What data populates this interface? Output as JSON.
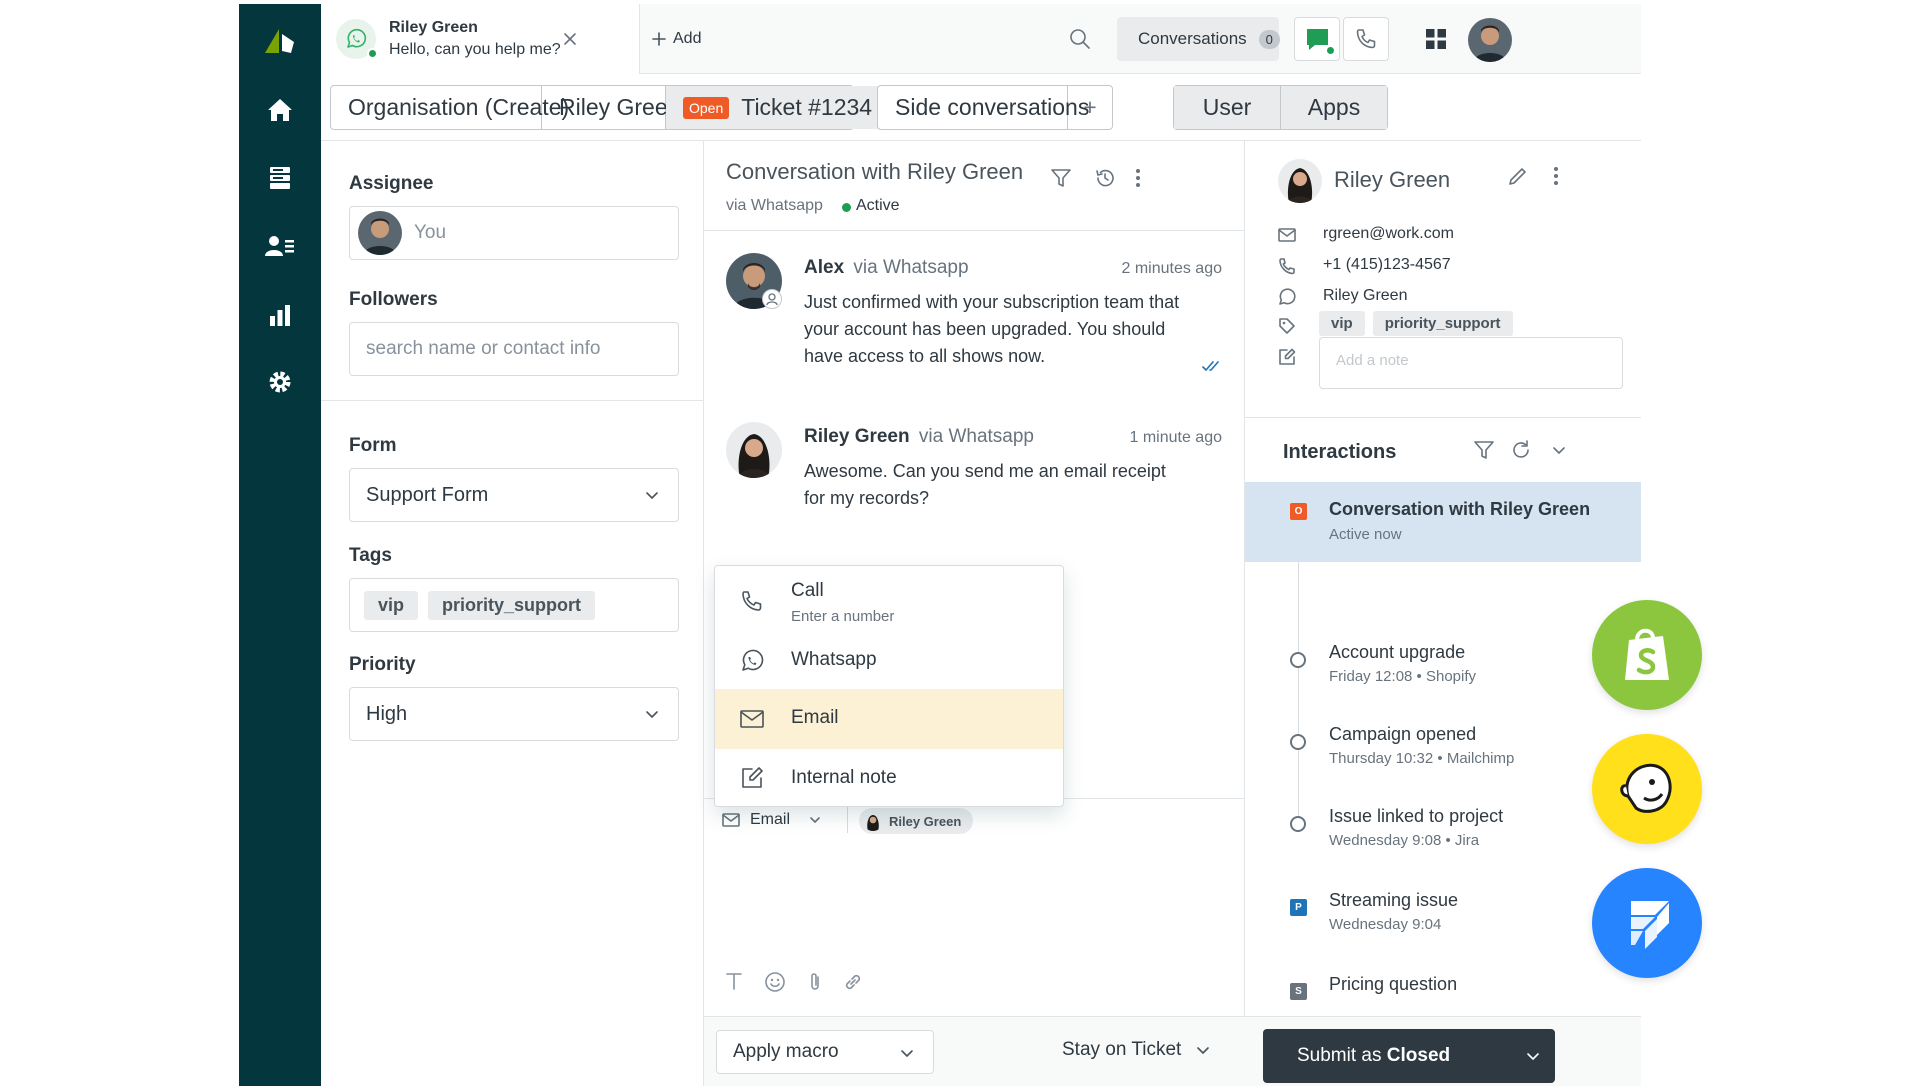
{
  "colors": {
    "nav_bg": "#03363d",
    "brand_green": "#78a300",
    "whatsapp_green": "#37b06a",
    "active_green": "#1f9d55",
    "open_orange": "#ef5b27",
    "highlight_blue": "#d6e4f2",
    "highlight_yellow": "#fcf1d5",
    "submit_dark": "#2f3941",
    "shopify_green": "#8cc63f",
    "mailchimp_yellow": "#ffe01b",
    "jira_blue": "#2684ff"
  },
  "nav": {
    "items": [
      "zendesk-logo",
      "home-icon",
      "views-icon",
      "customers-icon",
      "reporting-icon",
      "settings-icon"
    ]
  },
  "topbar": {
    "conversation_tab": {
      "name": "Riley Green",
      "preview": "Hello, can you help me?"
    },
    "add_label": "Add",
    "conversations_label": "Conversations",
    "conversations_count": "0"
  },
  "tabs": {
    "organisation": "Organisation (Create)",
    "requester": "Riley Green",
    "status_badge": "Open",
    "ticket": "Ticket #1234",
    "side_conversations": "Side conversations",
    "plus": "+",
    "user": "User",
    "apps": "Apps"
  },
  "left_panel": {
    "assignee_label": "Assignee",
    "assignee_value": "You",
    "followers_label": "Followers",
    "followers_placeholder": "search name or contact info",
    "form_label": "Form",
    "form_value": "Support Form",
    "tags_label": "Tags",
    "tags": [
      "vip",
      "priority_support"
    ],
    "priority_label": "Priority",
    "priority_value": "High"
  },
  "conversation": {
    "title": "Conversation with Riley Green",
    "channel": "via Whatsapp",
    "status": "Active",
    "messages": [
      {
        "author": "Alex",
        "via": "via Whatsapp",
        "time": "2 minutes ago",
        "lines": [
          "Just confirmed with your subscription team that",
          "your account has been upgraded. You should",
          "have access to all shows now."
        ]
      },
      {
        "author": "Riley Green",
        "via": "via Whatsapp",
        "time": "1 minute ago",
        "lines": [
          "Awesome. Can you send me an email receipt",
          "for my records?"
        ]
      }
    ],
    "channel_menu": {
      "call": "Call",
      "call_sub": "Enter a number",
      "whatsapp": "Whatsapp",
      "email": "Email",
      "internal_note": "Internal note"
    },
    "composer": {
      "channel": "Email",
      "recipient": "Riley Green"
    }
  },
  "bottom_bar": {
    "apply_macro": "Apply macro",
    "stay_on_ticket": "Stay on Ticket",
    "submit_prefix": "Submit as ",
    "submit_status": "Closed"
  },
  "right_panel": {
    "user_name": "Riley Green",
    "email": "rgreen@work.com",
    "phone": "+1 (415)123-4567",
    "whatsapp": "Riley Green",
    "tags": [
      "vip",
      "priority_support"
    ],
    "note_placeholder": "Add a note",
    "interactions_label": "Interactions",
    "interactions": [
      {
        "title": "Conversation with Riley Green",
        "sub": "Active now",
        "marker": "O"
      },
      {
        "title": "Account upgrade",
        "sub": "Friday 12:08 • Shopify"
      },
      {
        "title": "Campaign opened",
        "sub": "Thursday 10:32 • Mailchimp"
      },
      {
        "title": "Issue linked to project",
        "sub": "Wednesday 9:08 • Jira"
      },
      {
        "title": "Streaming issue",
        "sub": "Wednesday 9:04",
        "marker": "P"
      },
      {
        "title": "Pricing question",
        "sub": "",
        "marker": "S"
      }
    ]
  }
}
